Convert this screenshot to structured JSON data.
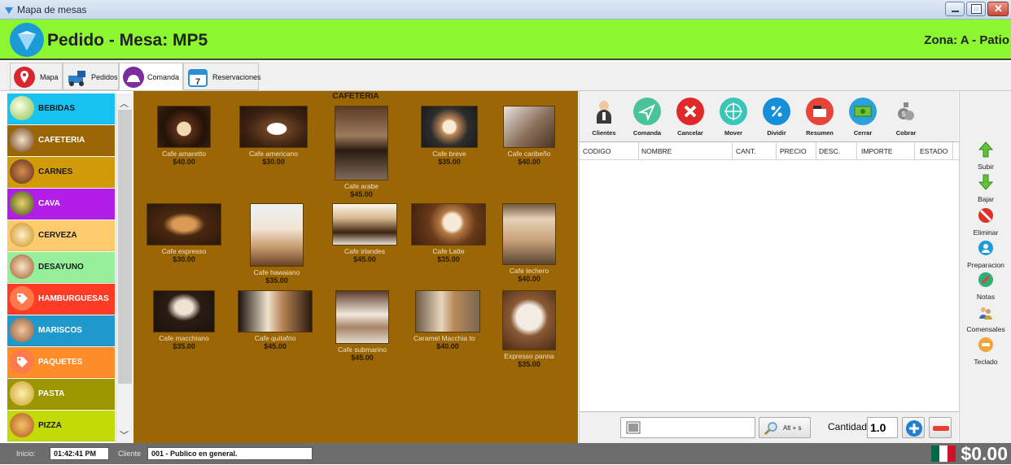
{
  "window": {
    "title": "Mapa de mesas"
  },
  "header": {
    "title": "Pedido - Mesa: MP5",
    "zona": "Zona: A - Patio"
  },
  "tabs": [
    {
      "label": "Mapa",
      "icon": "map-pin-icon"
    },
    {
      "label": "Pedidos",
      "icon": "delivery-icon"
    },
    {
      "label": "Comanda",
      "icon": "cloche-icon"
    },
    {
      "label": "Reservaciones",
      "icon": "calendar-icon",
      "badge": "7"
    }
  ],
  "categories": [
    {
      "label": "BEBIDAS",
      "color": "#17c3f3"
    },
    {
      "label": "CAFETERIA",
      "color": "#9b6605"
    },
    {
      "label": "CARNES",
      "color": "#d09a08"
    },
    {
      "label": "CAVA",
      "color": "#b21de8"
    },
    {
      "label": "CERVEZA",
      "color": "#fecb6c"
    },
    {
      "label": "DESAYUNO",
      "color": "#95ef9b"
    },
    {
      "label": "HAMBURGUESAS",
      "color": "#fe3c26"
    },
    {
      "label": "MARISCOS",
      "color": "#1f98cb"
    },
    {
      "label": "PAQUETES",
      "color": "#fd8c29"
    },
    {
      "label": "PASTA",
      "color": "#9c9600"
    },
    {
      "label": "PIZZA",
      "color": "#c2da05"
    }
  ],
  "products_heading": "CAFETERIA",
  "products": [
    {
      "name": "Cafe amaretto",
      "price": "$40.00"
    },
    {
      "name": "Cafe americano",
      "price": "$30.00"
    },
    {
      "name": "Cafe arabe",
      "price": "$45.00"
    },
    {
      "name": "Cafe breve",
      "price": "$35.00"
    },
    {
      "name": "Cafe caribeño",
      "price": "$40.00"
    },
    {
      "name": "Cafe expresso",
      "price": "$30.00"
    },
    {
      "name": "Cafe hawaiano",
      "price": "$35.00"
    },
    {
      "name": "Cafe irlandes",
      "price": "$45.00"
    },
    {
      "name": "Cafe Latte",
      "price": "$35.00"
    },
    {
      "name": "Cafe lechero",
      "price": "$40.00"
    },
    {
      "name": "Cafe macchiano",
      "price": "$35.00"
    },
    {
      "name": "Cafe quitafrio",
      "price": "$45.00"
    },
    {
      "name": "Cafe submarino",
      "price": "$45.00"
    },
    {
      "name": "Caramel Macchia to",
      "price": "$40.00"
    },
    {
      "name": "Expresso panna",
      "price": "$35.00"
    }
  ],
  "toolbar": [
    {
      "label": "Clientes",
      "color": "#f0f0f0"
    },
    {
      "label": "Comanda",
      "color": "#49c39a"
    },
    {
      "label": "Cancelar",
      "color": "#e02828"
    },
    {
      "label": "Mover",
      "color": "#39c6b8"
    },
    {
      "label": "Dividir",
      "color": "#1590d8"
    },
    {
      "label": "Resumen",
      "color": "#e84338"
    },
    {
      "label": "Cerrar",
      "color": "#2aa1d8"
    },
    {
      "label": "Cobrar",
      "color": "#f0f0f0"
    }
  ],
  "order_table": {
    "columns": [
      "CODIGO",
      "NOMBRE",
      "CANT.",
      "PRECIO",
      "DESC.",
      "IMPORTE",
      "ESTADO"
    ],
    "rows": []
  },
  "bottom": {
    "search_label": "Alt + s",
    "cantidad_label": "Cantidad:",
    "cantidad_value": "1.0"
  },
  "side_buttons": [
    {
      "label": "Subir"
    },
    {
      "label": "Bajar"
    },
    {
      "label": "Eliminar"
    },
    {
      "label": "Preparacion"
    },
    {
      "label": "Notas"
    },
    {
      "label": "Comensales"
    },
    {
      "label": "Teclado"
    }
  ],
  "status": {
    "inicio_label": "Inicio:",
    "inicio_value": "01:42:41 PM",
    "cliente_label": "Cliente",
    "cliente_value": "001 - Publico en general.",
    "total": "$0.00"
  }
}
